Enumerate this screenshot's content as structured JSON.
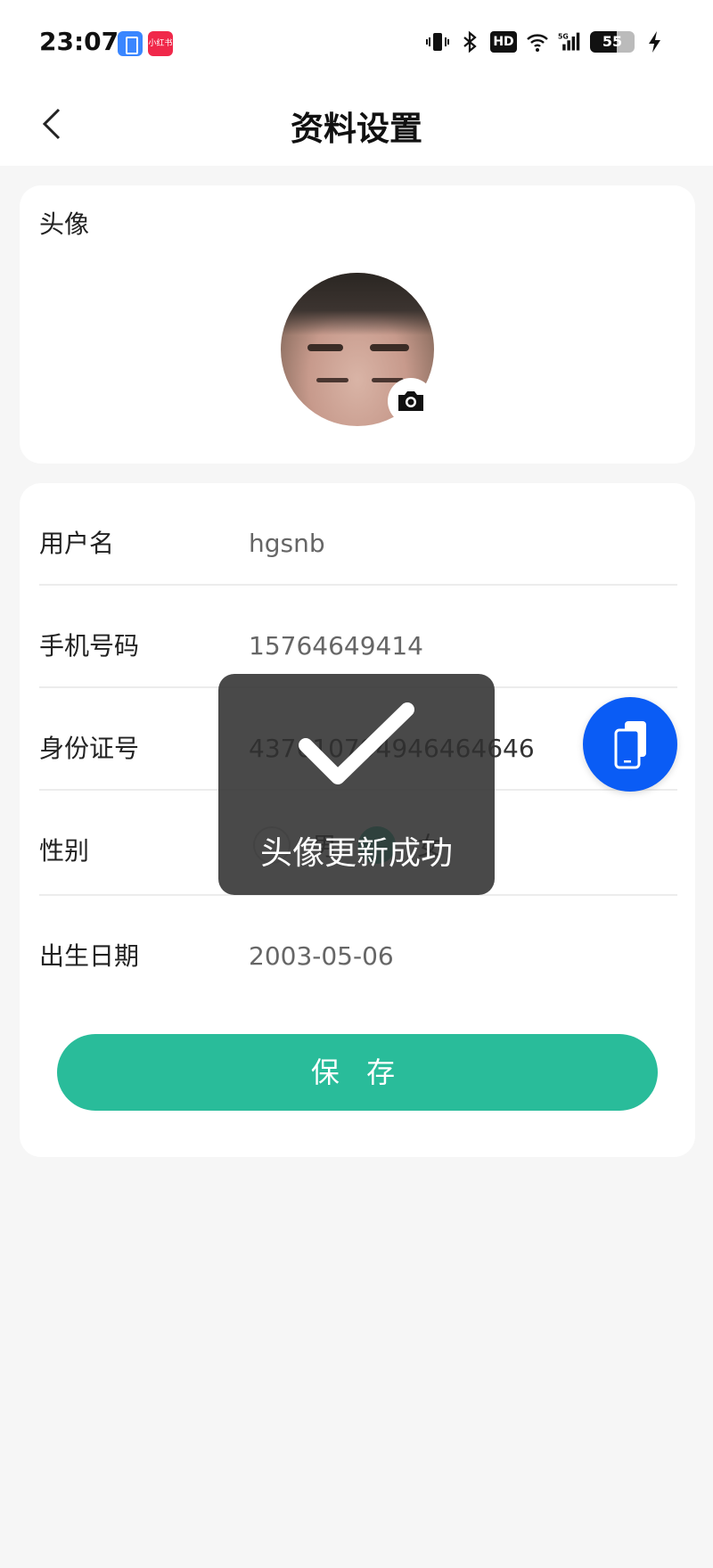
{
  "status_bar": {
    "time": "23:07",
    "app2_badge": "小红书",
    "hd_label": "HD",
    "network": "5G",
    "battery_level": "55",
    "app1_icon": "phone-clone-app-icon",
    "app2_icon": "xiaohongshu-app-icon"
  },
  "header": {
    "title": "资料设置",
    "back_icon": "chevron-left-icon"
  },
  "avatar_section": {
    "label": "头像",
    "camera_icon": "camera-icon"
  },
  "form": {
    "username": {
      "label": "用户名",
      "value": "hgsnb"
    },
    "phone": {
      "label": "手机号码",
      "value": "15764649414"
    },
    "id_number": {
      "label": "身份证号",
      "value": "437610794946464646"
    },
    "gender": {
      "label": "性别",
      "options": [
        "男",
        "女"
      ],
      "selected": "女"
    },
    "birth_date": {
      "label": "出生日期",
      "value": "2003-05-06"
    }
  },
  "save_button": {
    "label": "保 存"
  },
  "fab": {
    "icon": "phone-clone-icon"
  },
  "toast": {
    "message": "头像更新成功",
    "icon": "checkmark-icon"
  },
  "colors": {
    "accent_green": "#29bc9a",
    "fab_blue": "#0a5cf5",
    "background": "#f6f6f6"
  }
}
